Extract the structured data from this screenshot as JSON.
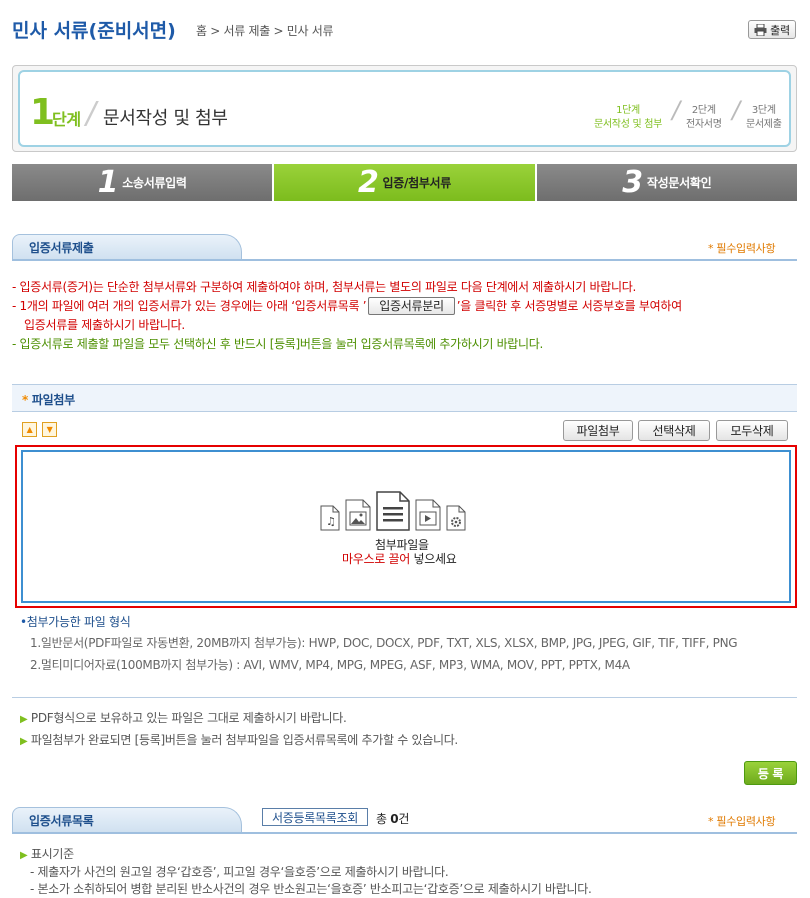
{
  "header": {
    "title": "민사 서류(준비서면)",
    "breadcrumb": "홈 > 서류 제출 > 민사 서류",
    "print": "출력"
  },
  "stage": {
    "num": "1",
    "word": "단계",
    "desc": "문서작성 및 첨부",
    "mini": [
      {
        "a": "1단계",
        "b": "문서작성 및 첨부"
      },
      {
        "a": "2단계",
        "b": "전자서명"
      },
      {
        "a": "3단계",
        "b": "문서제출"
      }
    ]
  },
  "tabs": [
    {
      "n": "1",
      "label": "소송서류입력"
    },
    {
      "n": "2",
      "label": "입증/첨부서류"
    },
    {
      "n": "3",
      "label": "작성문서확인"
    }
  ],
  "section1": {
    "title": "입증서류제출",
    "required": "* 필수입력사항"
  },
  "notes": {
    "l1": "- 입증서류(증거)는 단순한 첨부서류와 구분하여 제출하여야 하며, 첨부서류는 별도의 파일로 다음 단계에서 제출하시기 바랍니다.",
    "l2a": "- 1개의 파일에 여러 개의 입증서류가 있는 경우에는 아래 ‘입증서류목록 ’",
    "split_btn": "입증서류분리",
    "l2b": "’을 클릭한 후 서증명별로 서증부호를 부여하여",
    "l3": "입증서류를 제출하시기 바랍니다.",
    "l4": "- 입증서류로 제출할 파일을 모두 선택하신 후 반드시 [등록]버튼을 눌러 입증서류목록에 추가하시기 바랍니다."
  },
  "file": {
    "title": "파일첨부",
    "attach": "파일첨부",
    "del_sel": "선택삭제",
    "del_all": "모두삭제",
    "drop1": "첨부파일을",
    "drop_red": "마우스로 끌어",
    "drop2": " 넣으세요"
  },
  "formats": {
    "title": "첨부가능한 파일 형식",
    "l1": "1.일반문서(PDF파일로 자동변환, 20MB까지 첨부가능): HWP, DOC, DOCX, PDF, TXT, XLS, XLSX, BMP, JPG, JPEG, GIF, TIF, TIFF, PNG",
    "l2": "2.멀티미디어자료(100MB까지 첨부가능) : AVI, WMV, MP4, MPG, MPEG, ASF, MP3, WMA, MOV, PPT, PPTX, M4A"
  },
  "tips": [
    "PDF형식으로 보유하고 있는 파일은 그대로 제출하시기 바랍니다.",
    "파일첨부가 완료되면 [등록]버튼을 눌러 첨부파일을 입증서류목록에 추가할 수 있습니다."
  ],
  "register": "등 록",
  "section2": {
    "title": "입증서류목록",
    "lookup": "서증등록목록조회",
    "total_a": "총 ",
    "total_n": "0",
    "total_b": "건",
    "required": "* 필수입력사항"
  },
  "standard": {
    "title": "표시기준",
    "l1": "- 제출자가 사건의 원고일 경우‘갑호증’, 피고일 경우‘을호증’으로 제출하시기 바랍니다.",
    "l2": "- 본소가 소취하되어 병합 분리된 반소사건의 경우 반소원고는‘을호증’ 반소피고는‘갑호증’으로 제출하시기 바랍니다."
  }
}
